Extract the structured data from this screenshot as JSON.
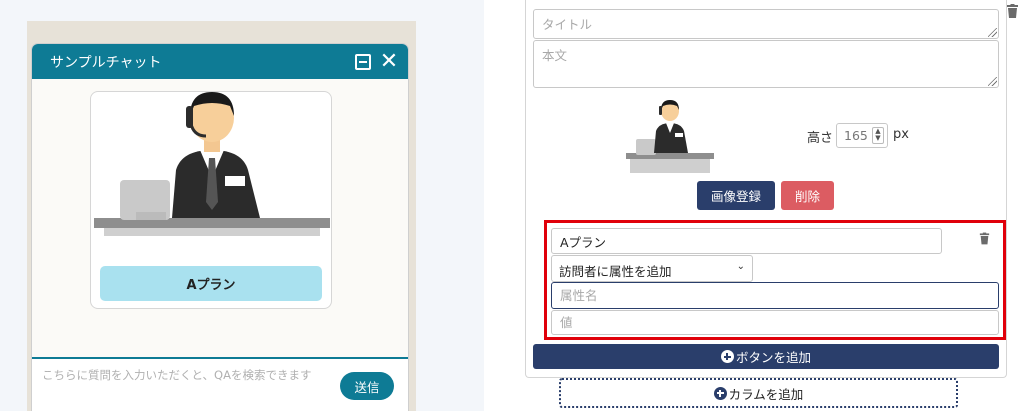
{
  "chat": {
    "title": "サンプルチャット",
    "card_button_label": "Aプラン",
    "input_placeholder": "こちらに質問を入力いただくと、QAを検索できます",
    "send_label": "送信"
  },
  "editor": {
    "title_placeholder": "タイトル",
    "body_placeholder": "本文",
    "height_label": "高さ",
    "height_value": "165",
    "height_unit": "px",
    "register_image_label": "画像登録",
    "delete_label": "削除",
    "button_text_value": "Aプラン",
    "attribute_select_value": "訪問者に属性を追加",
    "attribute_name_placeholder": "属性名",
    "attribute_value_placeholder": "値",
    "add_button_label": "ボタンを追加",
    "add_column_label": "カラムを追加"
  },
  "colors": {
    "chat_header": "#0e7b95",
    "card_button": "#a9e1ef",
    "primary_navy": "#2a3e6b",
    "danger": "#dc5c62",
    "highlight_border": "#e0000a"
  },
  "icons": [
    "minimize-icon",
    "close-icon",
    "trash-icon",
    "plus-circle-icon",
    "chevron-down-icon"
  ]
}
